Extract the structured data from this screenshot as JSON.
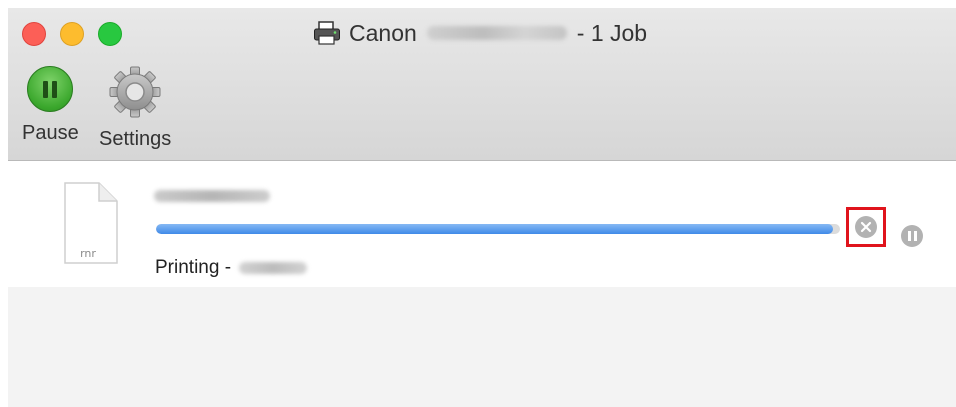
{
  "window": {
    "title_prefix": "Canon",
    "title_suffix": "- 1 Job",
    "title_icon": "printer-icon"
  },
  "toolbar": {
    "pause_label": "Pause",
    "settings_label": "Settings",
    "pause_icon": "pause-circle-icon",
    "settings_icon": "gear-icon"
  },
  "job": {
    "file_type_label": "rnr",
    "status_prefix": "Printing -",
    "progress": 0.99,
    "cancel_icon": "cancel-circle-icon",
    "pause_icon": "pause-circle-icon"
  },
  "colors": {
    "highlight": "#e0141c",
    "progress": "#3f8ae8",
    "pause_button": "#3aa72c"
  }
}
